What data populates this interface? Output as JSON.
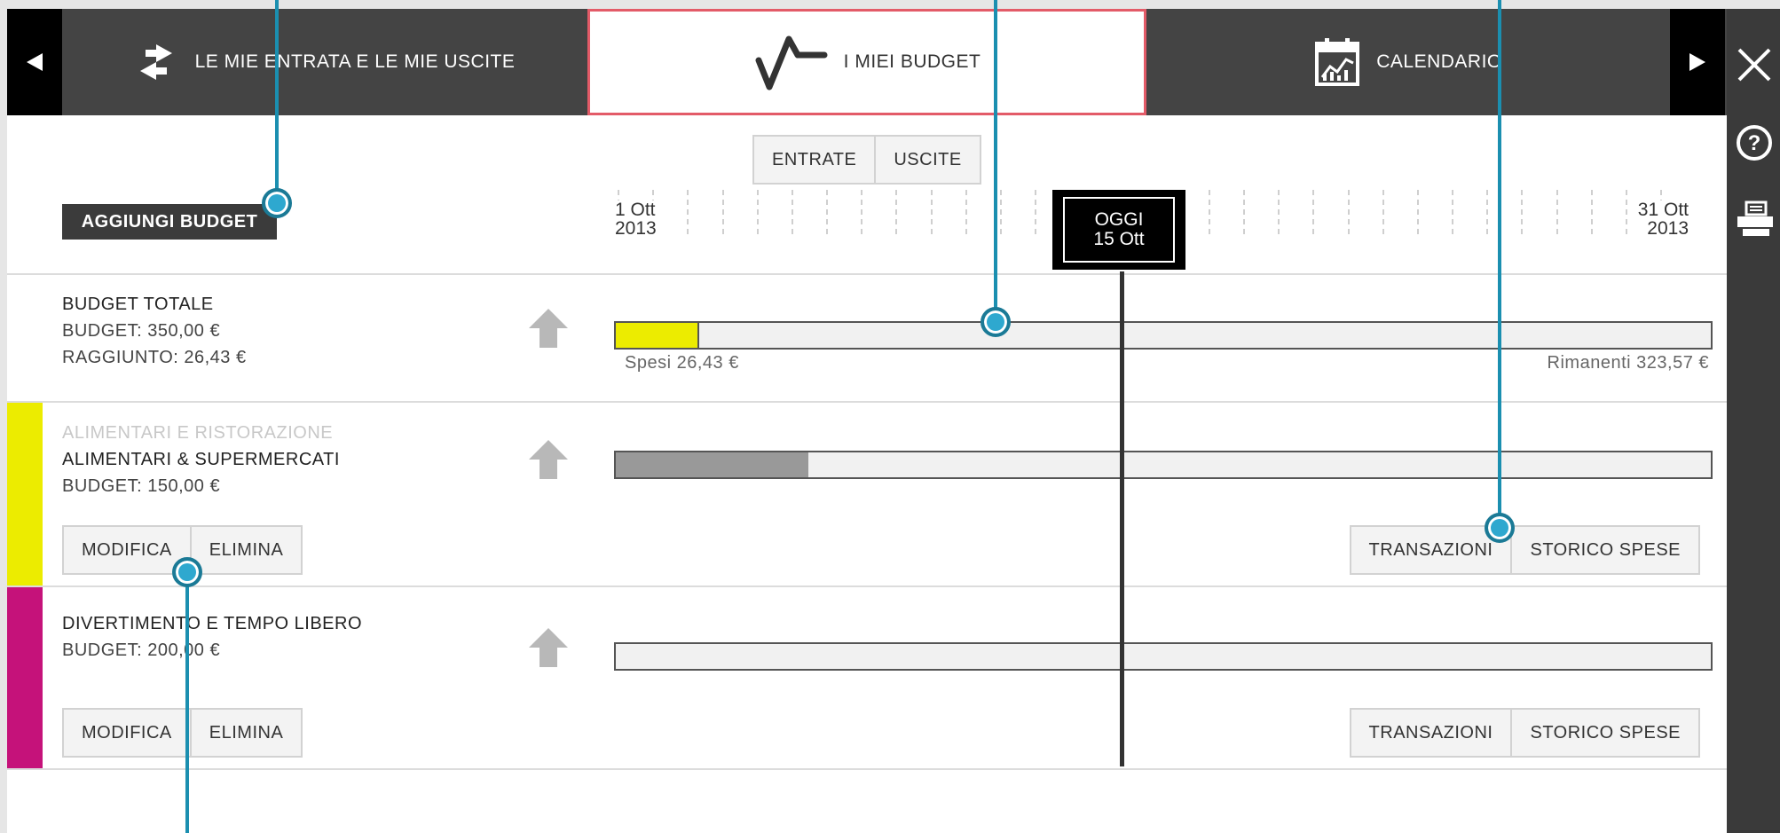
{
  "tabs": {
    "prev_arrow": "◀",
    "next_arrow": "▶",
    "items": [
      {
        "label": "LE MIE ENTRATA E LE MIE USCITE",
        "icon": "transfer-arrows-icon"
      },
      {
        "label": "I MIEI BUDGET",
        "icon": "pulse-chart-icon"
      },
      {
        "label": "CALENDARIO",
        "icon": "calendar-chart-icon"
      }
    ]
  },
  "toggle": {
    "entrate": "ENTRATE",
    "uscite": "USCITE"
  },
  "add_budget_label": "AGGIUNGI BUDGET",
  "timeline": {
    "start_day": "1 Ott",
    "start_year": "2013",
    "end_day": "31 Ott",
    "end_year": "2013",
    "today_label": "OGGI",
    "today_date": "15 Ott"
  },
  "total": {
    "title": "BUDGET TOTALE",
    "budget": "BUDGET: 350,00 €",
    "reached": "RAGGIUNTO: 26,43 €",
    "spent_label": "Spesi 26,43 €",
    "remaining_label": "Rimanenti 323,57 €",
    "progress": 0.076,
    "fill_color": "#ecec00"
  },
  "budgets": [
    {
      "category": "ALIMENTARI E RISTORAZIONE",
      "name": "ALIMENTARI & SUPERMERCATI",
      "budget": "BUDGET: 150,00 €",
      "color": "#ecec00",
      "progress": 0.176,
      "fill_color": "#999999"
    },
    {
      "category": "",
      "name": "DIVERTIMENTO E TEMPO LIBERO",
      "budget": "BUDGET: 200,00 €",
      "color": "#c5127a",
      "progress": 0,
      "fill_color": "#999999"
    }
  ],
  "row_buttons": {
    "edit": "MODIFICA",
    "delete": "ELIMINA",
    "transactions": "TRANSAZIONI",
    "history": "STORICO SPESE"
  },
  "side_panel": {
    "icons": [
      "close-icon",
      "help-icon",
      "print-icon"
    ]
  },
  "colors": {
    "accent_border": "#e35b68",
    "callout": "#2ea8cf",
    "tab_bg": "#444444"
  }
}
